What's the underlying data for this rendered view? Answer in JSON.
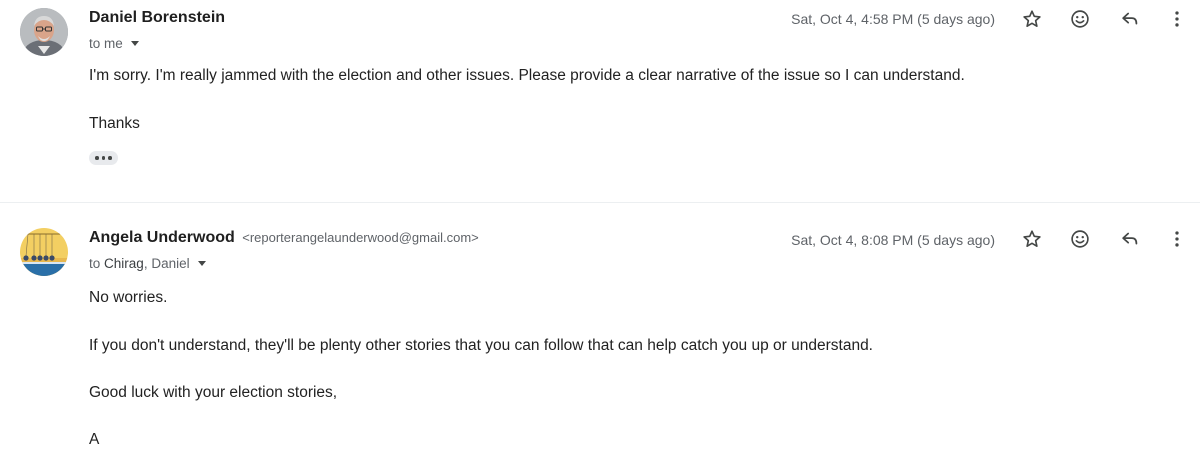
{
  "messages": [
    {
      "sender_name": "Daniel Borenstein",
      "sender_email": "",
      "recipients_prefix": "to",
      "recipients": "me",
      "timestamp": "Sat, Oct 4, 4:58 PM (5 days ago)",
      "paragraphs": [
        "I'm sorry. I'm really jammed with the election and other issues. Please provide a clear narrative of the issue so I can understand.",
        "Thanks"
      ],
      "avatar": "person-photo-avatar"
    },
    {
      "sender_name": "Angela Underwood",
      "sender_email": "<reporterangelaunderwood@gmail.com>",
      "recipients_prefix": "to",
      "recipients_first": "Chirag",
      "recipients_rest": ", Daniel",
      "timestamp": "Sat, Oct 4, 8:08 PM (5 days ago)",
      "paragraphs": [
        "No worries.",
        "If you don't understand, they'll be plenty other stories that you can follow that can help catch you up or understand.",
        "Good luck with your election stories,",
        "A"
      ],
      "avatar": "newtons-cradle-avatar"
    }
  ],
  "icons": {
    "star": "star-outline-icon",
    "emoji": "add-reaction-icon",
    "reply": "reply-icon",
    "more": "more-vert-icon",
    "show_trimmed": "more-horiz-icon"
  },
  "colors": {
    "text_primary": "#1f1f1f",
    "text_secondary": "#5f6368",
    "icon": "#444746",
    "divider": "#eceff1",
    "avatar2_top": "#f3cf62",
    "avatar2_bottom": "#2a6fa8"
  }
}
